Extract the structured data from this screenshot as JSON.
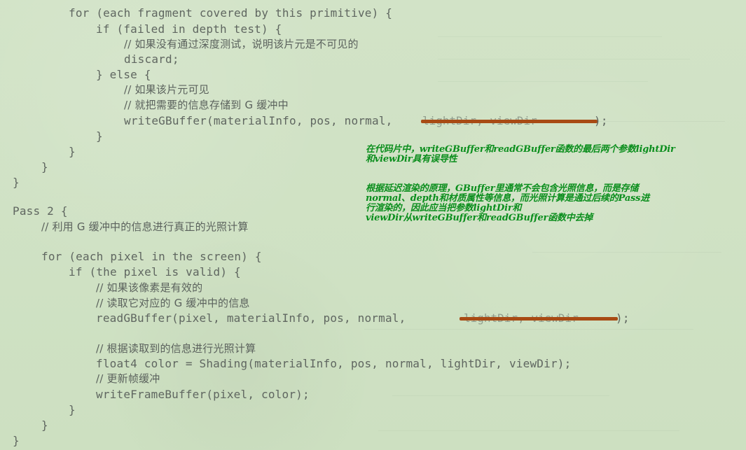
{
  "code": {
    "line_01": "for (each fragment covered by this primitive) {",
    "line_02": "if (failed in depth test) {",
    "line_03": "// 如果没有通过深度测试，说明该片元是不可见的",
    "line_04": "discard;",
    "line_05": "} else {",
    "line_06": "// 如果该片元可见",
    "line_07": "// 就把需要的信息存储到 G 缓冲中",
    "line_08_prefix": "writeGBuffer(materialInfo, pos, normal,",
    "line_08_struck": "lightDir, viewDir",
    "line_08_suffix": ");",
    "line_09": "}",
    "line_10": "}",
    "line_11": "}",
    "line_12": "}",
    "line_13": "Pass 2 {",
    "line_14": "// 利用 G 缓冲中的信息进行真正的光照计算",
    "line_15": "for (each pixel in the screen) {",
    "line_16": "if (the pixel is valid) {",
    "line_17": "// 如果该像素是有效的",
    "line_18": "// 读取它对应的 G 缓冲中的信息",
    "line_19_prefix": "readGBuffer(pixel, materialInfo, pos, normal,",
    "line_19_struck": "lightDir, viewDir",
    "line_19_suffix": ");",
    "line_20": "// 根据读取到的信息进行光照计算",
    "line_21": "float4 color = Shading(materialInfo, pos, normal, lightDir, viewDir);",
    "line_22": "// 更新帧缓冲",
    "line_23": "writeFrameBuffer(pixel, color);",
    "line_24": "}",
    "line_25": "}",
    "line_26": "}"
  },
  "annotation": {
    "note_1_line_1": "在代码片中，writeGBuffer和readGBuffer函数的最后两个参数lightDir",
    "note_1_line_2": "和viewDir具有误导性",
    "note_2_line_1": "根据延迟渲染的原理，GBuffer里通常不会包含光照信息，而是存储",
    "note_2_line_2": "normal、depth和材质属性等信息，而光照计算是通过后续的Pass进",
    "note_2_line_3": "行渲染的，因此应当把参数lightDir和",
    "note_2_line_4": "viewDir从writeGBuffer和readGBuffer函数中去掉"
  },
  "colors": {
    "background": "#cfe0c4",
    "code_text": "#5f6660",
    "note_text": "#0b8e1d",
    "strike": "#a84b14"
  }
}
